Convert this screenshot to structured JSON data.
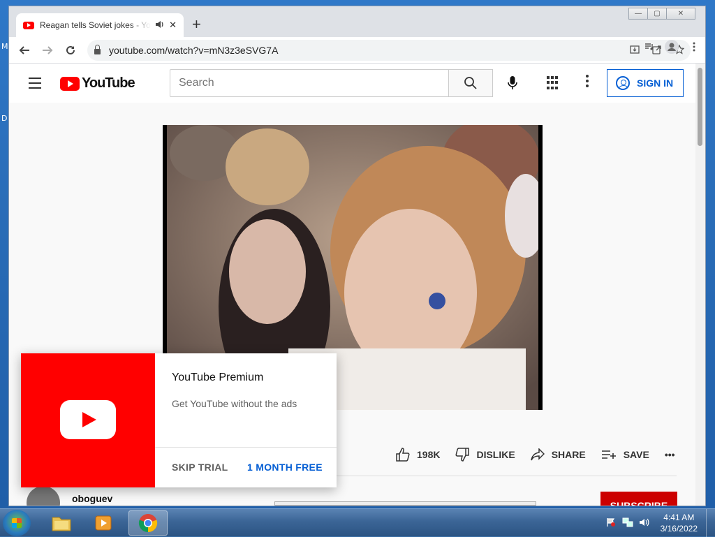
{
  "desktop": {
    "letters": [
      "M",
      "D"
    ]
  },
  "browser": {
    "tab": {
      "title": "Reagan tells Soviet jokes - YouTube",
      "audio_icon": "speaker-icon",
      "close": "✕"
    },
    "new_tab": "+",
    "window_buttons": {
      "minimize": "—",
      "maximize": "▢",
      "close": "✕"
    },
    "url": "youtube.com/watch?v=mN3z3eSVG7A"
  },
  "youtube": {
    "logo_text": "YouTube",
    "search_placeholder": "Search",
    "sign_in": "SIGN IN",
    "likes": "198K",
    "dislike": "DISLIKE",
    "share": "SHARE",
    "save": "SAVE",
    "more": "•••",
    "channel": "oboguev",
    "subscribe": "SUBSCRIBE"
  },
  "premium": {
    "title": "YouTube Premium",
    "subtitle": "Get YouTube without the ads",
    "skip": "SKIP TRIAL",
    "free": "1 MONTH FREE"
  },
  "taskbar": {
    "time": "4:41 AM",
    "date": "3/16/2022"
  },
  "colors": {
    "youtube_red": "#ff0000",
    "link_blue": "#065fd4",
    "taskbar": "#2c5483"
  }
}
